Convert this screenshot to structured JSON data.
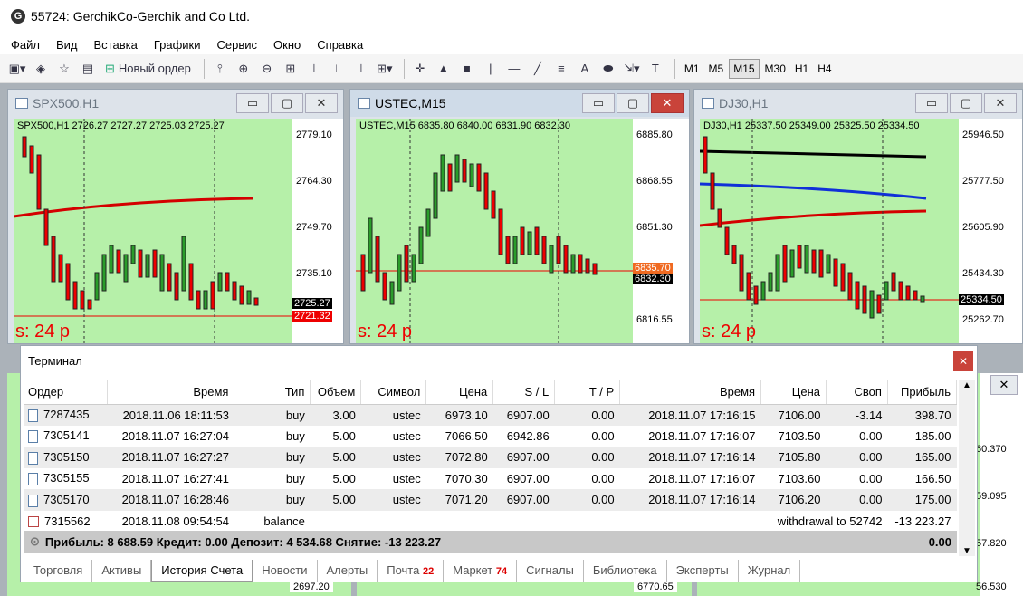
{
  "window": {
    "title": "55724: GerchikCo-Gerchik and Co Ltd."
  },
  "menu": [
    "Файл",
    "Вид",
    "Вставка",
    "Графики",
    "Сервис",
    "Окно",
    "Справка"
  ],
  "toolbar": {
    "new_order": "Новый ордер",
    "timeframes": [
      "M1",
      "M5",
      "M15",
      "M30",
      "H1",
      "H4"
    ],
    "active_timeframe": "M15"
  },
  "charts": [
    {
      "title": "SPX500,H1",
      "ohlc": "SPX500,H1  2726.27 2727.27 2725.03 2725.27",
      "prices": [
        "2779.10",
        "2764.30",
        "2749.70",
        "2735.10"
      ],
      "tag_current": "2725.27",
      "tag_line": "2721.32",
      "spread": "s: 24 p"
    },
    {
      "title": "USTEC,M15",
      "ohlc": "USTEC,M15  6835.80 6840.00 6831.90 6832.30",
      "prices": [
        "6885.80",
        "6868.55",
        "6851.30",
        "6816.55"
      ],
      "tag_line": "6835.70",
      "tag_current": "6832.30",
      "spread": "s: 24 p"
    },
    {
      "title": "DJ30,H1",
      "ohlc": "DJ30,H1  25337.50 25349.00 25325.50 25334.50",
      "prices": [
        "25946.50",
        "25777.50",
        "25605.90",
        "25434.30",
        "25262.70"
      ],
      "tag_current": "25334.50",
      "spread": "s: 24 p"
    }
  ],
  "background_axis": {
    "left_bottom": "2697.20",
    "mid_bottom": "6770.65",
    "right": [
      "60.370",
      "59.095",
      "57.820",
      "56.530"
    ]
  },
  "terminal": {
    "title": "Терминал",
    "columns": [
      "Ордер",
      "Время",
      "Тип",
      "Объем",
      "Символ",
      "Цена",
      "S / L",
      "T / P",
      "Время",
      "Цена",
      "Своп",
      "Прибыль"
    ],
    "rows": [
      [
        "7287435",
        "2018.11.06 18:11:53",
        "buy",
        "3.00",
        "ustec",
        "6973.10",
        "6907.00",
        "0.00",
        "2018.11.07 17:16:15",
        "7106.00",
        "-3.14",
        "398.70"
      ],
      [
        "7305141",
        "2018.11.07 16:27:04",
        "buy",
        "5.00",
        "ustec",
        "7066.50",
        "6942.86",
        "0.00",
        "2018.11.07 17:16:07",
        "7103.50",
        "0.00",
        "185.00"
      ],
      [
        "7305150",
        "2018.11.07 16:27:27",
        "buy",
        "5.00",
        "ustec",
        "7072.80",
        "6907.00",
        "0.00",
        "2018.11.07 17:16:14",
        "7105.80",
        "0.00",
        "165.00"
      ],
      [
        "7305155",
        "2018.11.07 16:27:41",
        "buy",
        "5.00",
        "ustec",
        "7070.30",
        "6907.00",
        "0.00",
        "2018.11.07 17:16:07",
        "7103.60",
        "0.00",
        "166.50"
      ],
      [
        "7305170",
        "2018.11.07 16:28:46",
        "buy",
        "5.00",
        "ustec",
        "7071.20",
        "6907.00",
        "0.00",
        "2018.11.07 17:16:14",
        "7106.20",
        "0.00",
        "175.00"
      ]
    ],
    "balance_row": {
      "order": "7315562",
      "time": "2018.11.08 09:54:54",
      "type": "balance",
      "comment": "withdrawal to 52742",
      "profit": "-13 223.27"
    },
    "summary": {
      "text": "Прибыль: 8 688.59  Кредит: 0.00  Депозит: 4 534.68  Снятие: -13 223.27",
      "total": "0.00"
    },
    "tabs": [
      {
        "label": "Торговля"
      },
      {
        "label": "Активы"
      },
      {
        "label": "История Счета",
        "active": true
      },
      {
        "label": "Новости"
      },
      {
        "label": "Алерты"
      },
      {
        "label": "Почта",
        "badge": "22"
      },
      {
        "label": "Маркет",
        "badge": "74"
      },
      {
        "label": "Сигналы"
      },
      {
        "label": "Библиотека"
      },
      {
        "label": "Эксперты"
      },
      {
        "label": "Журнал"
      }
    ]
  }
}
